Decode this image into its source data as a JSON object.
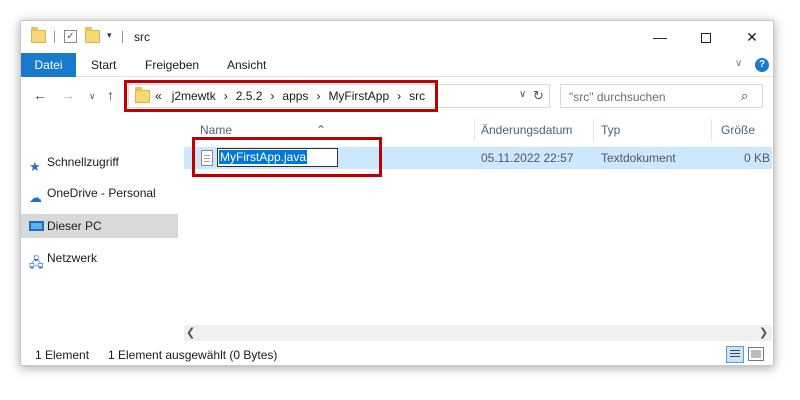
{
  "window": {
    "title": "src",
    "minimize_glyph": "—",
    "close_glyph": "✕"
  },
  "ribbon": {
    "tabs": [
      "Datei",
      "Start",
      "Freigeben",
      "Ansicht"
    ],
    "help_glyph": "?"
  },
  "navigation": {
    "back_glyph": "←",
    "forward_glyph": "→",
    "recent_glyph": "∨",
    "up_glyph": "↑"
  },
  "address": {
    "overflow": "«",
    "breadcrumbs": [
      "j2mewtk",
      "2.5.2",
      "apps",
      "MyFirstApp",
      "src"
    ],
    "separator": "›"
  },
  "search": {
    "placeholder": "\"src\" durchsuchen"
  },
  "sidebar": {
    "items": [
      {
        "label": "Schnellzugriff",
        "icon": "star-icon"
      },
      {
        "label": "OneDrive - Personal",
        "icon": "cloud-icon"
      },
      {
        "label": "Dieser PC",
        "icon": "computer-icon",
        "selected": true
      },
      {
        "label": "Netzwerk",
        "icon": "network-icon"
      }
    ]
  },
  "file_list": {
    "columns": [
      "Name",
      "Änderungsdatum",
      "Typ",
      "Größe"
    ],
    "rows": [
      {
        "name": "MyFirstApp.java",
        "modified": "05.11.2022 22:57",
        "type": "Textdokument",
        "size": "0 KB",
        "selected": true,
        "renaming": true
      }
    ]
  },
  "status": {
    "count": "1 Element",
    "selection": "1 Element ausgewählt (0 Bytes)"
  },
  "colors": {
    "accent": "#1979ca",
    "selection": "#cce8ff",
    "highlight_box": "#c00000"
  }
}
